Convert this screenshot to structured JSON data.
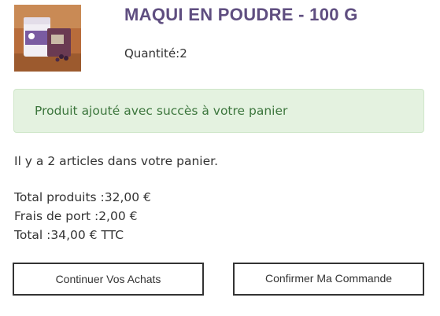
{
  "product": {
    "name": "MAQUI EN POUDRE - 100 G",
    "quantity_line": "Quantité:2",
    "thumbnail_icon": "product-photo"
  },
  "alert": {
    "message": "Produit ajouté avec succès à votre panier",
    "color": "#3c763d",
    "background": "#e4f2e0"
  },
  "cart": {
    "count_text": "Il y a 2 articles dans votre panier.",
    "total_products": "Total produits :32,00 €",
    "shipping": "Frais de port :2,00 €",
    "total": "Total :34,00 € TTC"
  },
  "actions": {
    "continue_label": "Continuer Vos Achats",
    "confirm_label": "Confirmer Ma Commande"
  },
  "colors": {
    "title": "#5f4e80",
    "button_border": "#333333"
  }
}
